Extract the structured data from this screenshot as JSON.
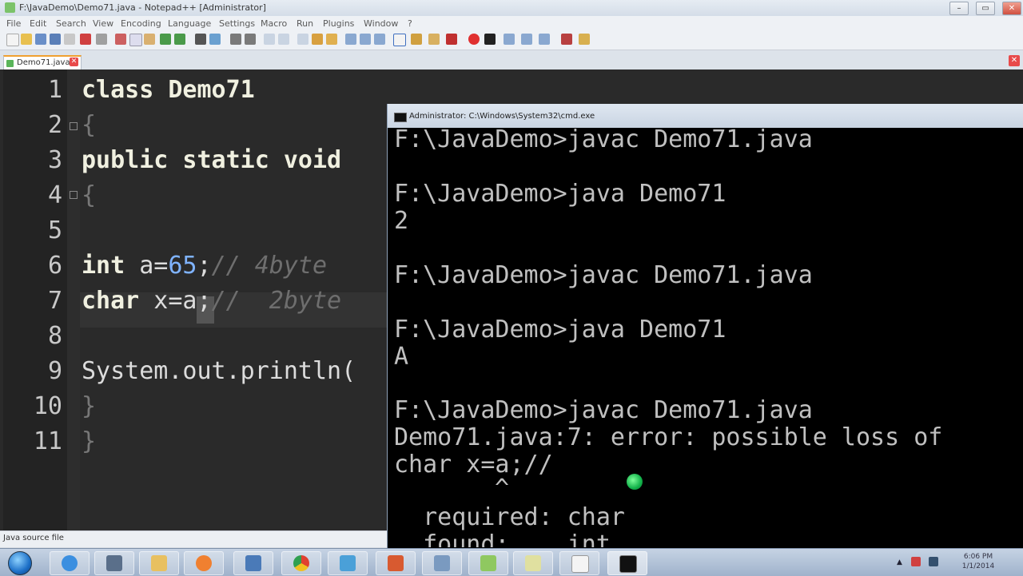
{
  "npp": {
    "title": "F:\\JavaDemo\\Demo71.java - Notepad++ [Administrator]",
    "menu": [
      "File",
      "Edit",
      "Search",
      "View",
      "Encoding",
      "Language",
      "Settings",
      "Macro",
      "Run",
      "Plugins",
      "Window",
      "?"
    ],
    "tab_label": "Demo71.java",
    "status": "Java source file",
    "line_numbers": [
      "1",
      "2",
      "3",
      "4",
      "5",
      "6",
      "7",
      "8",
      "9",
      "10",
      "11"
    ],
    "code": {
      "l1": "class Demo71",
      "l2": "{",
      "l3a": "public static void ",
      "l4": "{",
      "l6_kw": "int",
      "l6_var": " a=",
      "l6_num": "65",
      "l6_semi": ";",
      "l6_cm": "// 4byte",
      "l7_kw": "char",
      "l7_code": " x=a;",
      "l7_cm": "//  2byte",
      "l9": "System.out.println(",
      "l10": "}",
      "l11": "}"
    }
  },
  "cmd": {
    "title": "Administrator: C:\\Windows\\System32\\cmd.exe",
    "lines": [
      "F:\\JavaDemo>javac Demo71.java",
      "",
      "F:\\JavaDemo>java Demo71",
      "2",
      "",
      "F:\\JavaDemo>javac Demo71.java",
      "",
      "F:\\JavaDemo>java Demo71",
      "A",
      "",
      "F:\\JavaDemo>javac Demo71.java",
      "Demo71.java:7: error: possible loss of",
      "char x=a;//",
      "    ^",
      "  required: char",
      "  found:    int"
    ]
  },
  "tray": {
    "time": "6:06 PM",
    "date": "1/1/2014"
  }
}
